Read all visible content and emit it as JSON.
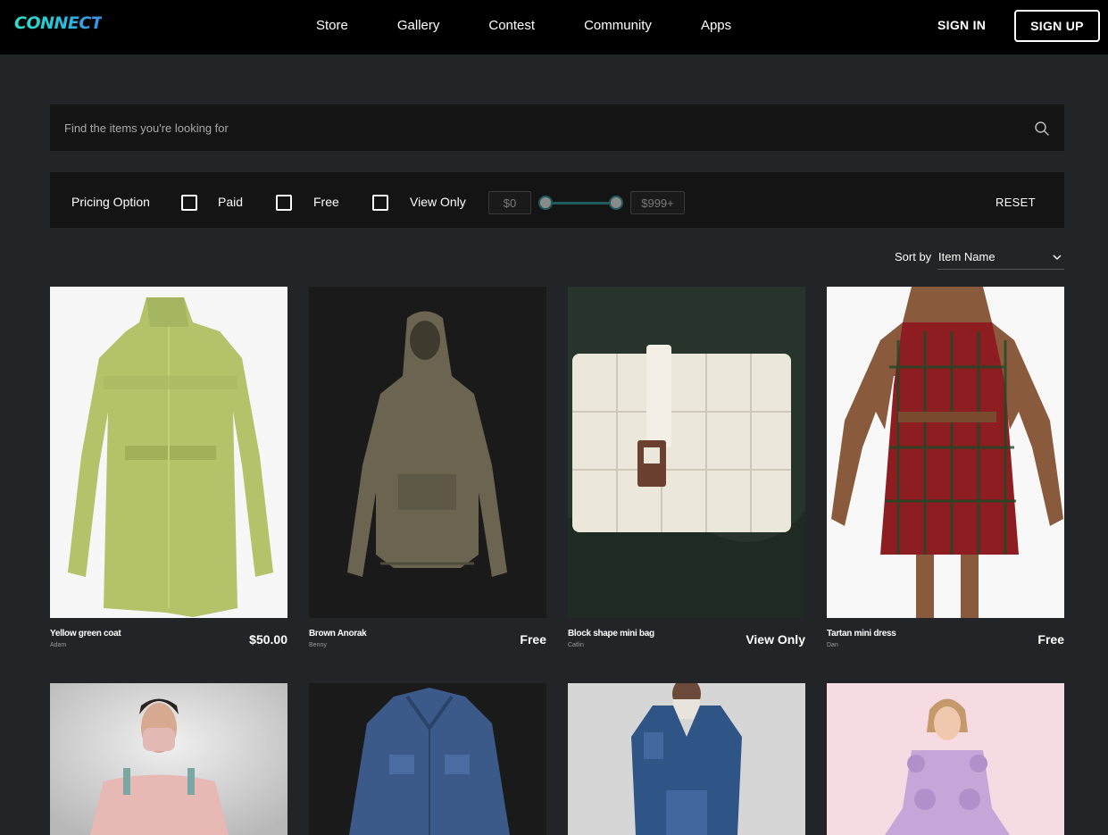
{
  "header": {
    "logo": "CONNECT",
    "nav": [
      "Store",
      "Gallery",
      "Contest",
      "Community",
      "Apps"
    ],
    "sign_in": "SIGN IN",
    "sign_up": "SIGN UP"
  },
  "search": {
    "placeholder": "Find the items you're looking for"
  },
  "filter": {
    "label": "Pricing Option",
    "options": [
      "Paid",
      "Free",
      "View Only"
    ],
    "min_price": "$0",
    "max_price": "$999+",
    "reset": "RESET"
  },
  "sort": {
    "label": "Sort by",
    "value": "Item Name"
  },
  "items": [
    {
      "title": "Yellow green coat",
      "author": "Adam",
      "price": "$50.00"
    },
    {
      "title": "Brown Anorak",
      "author": "Benny",
      "price": "Free"
    },
    {
      "title": "Block shape mini bag",
      "author": "Catlin",
      "price": "View Only"
    },
    {
      "title": "Tartan mini dress",
      "author": "Dan",
      "price": "Free"
    },
    {
      "title": "",
      "author": "",
      "price": ""
    },
    {
      "title": "",
      "author": "",
      "price": ""
    },
    {
      "title": "",
      "author": "",
      "price": ""
    },
    {
      "title": "",
      "author": "",
      "price": ""
    }
  ]
}
